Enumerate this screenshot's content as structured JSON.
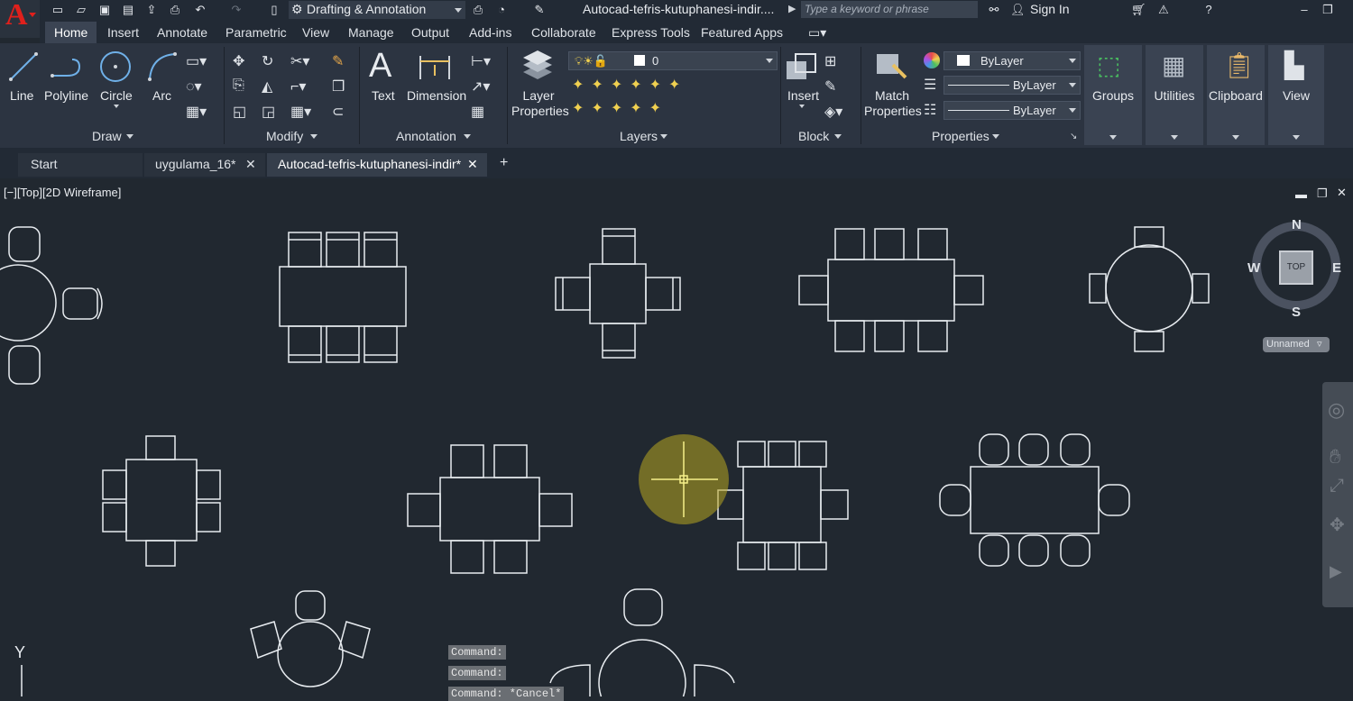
{
  "titlebar": {
    "workspace": "Drafting & Annotation",
    "window_title": "Autocad-tefris-kutuphanesi-indir....",
    "search_placeholder": "Type a keyword or phrase",
    "sign_in": "Sign In"
  },
  "ribbon_tabs": [
    "Home",
    "Insert",
    "Annotate",
    "Parametric",
    "View",
    "Manage",
    "Output",
    "Add-ins",
    "Collaborate",
    "Express Tools",
    "Featured Apps"
  ],
  "draw_panel": {
    "title": "Draw",
    "tools": [
      "Line",
      "Polyline",
      "Circle",
      "Arc"
    ]
  },
  "modify_panel": {
    "title": "Modify"
  },
  "annotation_panel": {
    "title": "Annotation",
    "tools": [
      "Text",
      "Dimension"
    ]
  },
  "layers_panel": {
    "title": "Layers",
    "layer_properties": "Layer Properties",
    "current_layer": "0"
  },
  "block_panel": {
    "title": "Block",
    "insert": "Insert"
  },
  "properties_panel": {
    "title": "Properties",
    "match": "Match Properties",
    "color": "ByLayer",
    "linetype": "ByLayer",
    "lineweight": "ByLayer"
  },
  "extra_panels": [
    "Groups",
    "Utilities",
    "Clipboard",
    "View"
  ],
  "file_tabs": [
    "Start",
    "uygulama_16*",
    "Autocad-tefris-kutuphanesi-indir*"
  ],
  "viewport_label": "[−][Top][2D Wireframe]",
  "viewcube": {
    "top": "TOP",
    "n": "N",
    "s": "S",
    "e": "E",
    "w": "W",
    "ucs": "Unnamed"
  },
  "command_lines": [
    "Command:",
    "Command:",
    "Command: *Cancel*"
  ],
  "axis_label": "Y"
}
